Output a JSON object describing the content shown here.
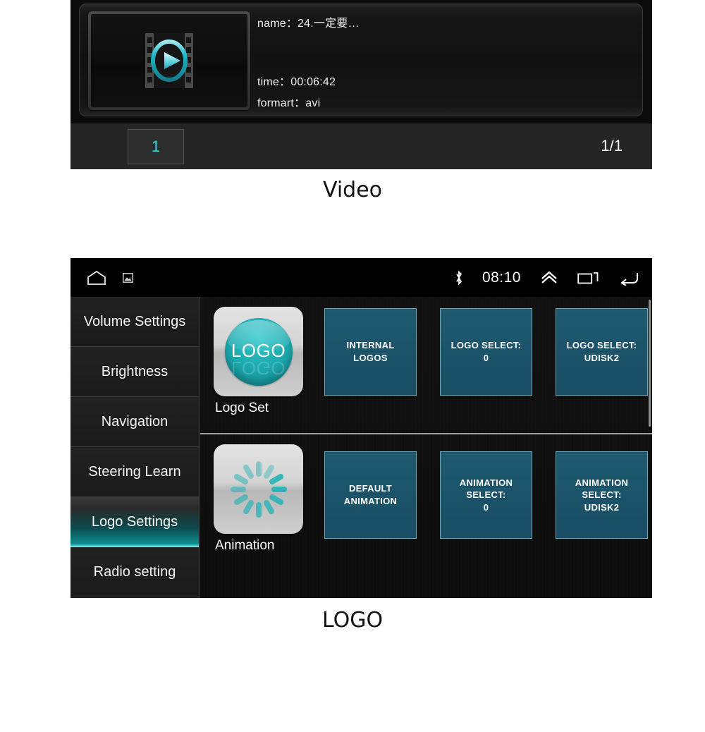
{
  "video_screen": {
    "caption": "Video",
    "item": {
      "thumbnail_icon": "film-play-icon",
      "name_label": "name：",
      "name_value": "24.一定要…",
      "time_label": "time：",
      "time_value": "00:06:42",
      "format_label": "formart：",
      "format_value": "avi"
    },
    "pagination": {
      "page_button": "1",
      "page_count": "1/1"
    },
    "colors": {
      "accent": "#2ae0e0",
      "background": "#0b0b0b",
      "bottom_bar": "#252525"
    }
  },
  "logo_screen": {
    "caption": "LOGO",
    "statusbar": {
      "home_icon": "home-icon",
      "screenshot_icon": "screenshot-icon",
      "bluetooth_icon": "bluetooth-icon",
      "time": "08:10",
      "expand_icon": "chevron-up-icon",
      "recents_icon": "recents-icon",
      "back_icon": "back-arrow-icon"
    },
    "sidebar": {
      "items": [
        {
          "label": "Volume Settings",
          "selected": false
        },
        {
          "label": "Brightness",
          "selected": false
        },
        {
          "label": "Navigation",
          "selected": false
        },
        {
          "label": "Steering Learn",
          "selected": false
        },
        {
          "label": "Logo Settings",
          "selected": true
        },
        {
          "label": "Radio setting",
          "selected": false
        }
      ]
    },
    "rows": [
      {
        "app_icon": "logo-icon",
        "app_icon_text": "LOGO",
        "app_label": "Logo Set",
        "tiles": [
          {
            "label": "INTERNAL LOGOS"
          },
          {
            "label": "LOGO SELECT:\n0"
          },
          {
            "label": "LOGO SELECT:\nUDISK2"
          }
        ]
      },
      {
        "app_icon": "spinner-icon",
        "app_label": "Animation",
        "tiles": [
          {
            "label": "DEFAULT\nANIMATION"
          },
          {
            "label": "ANIMATION\nSELECT:\n0"
          },
          {
            "label": "ANIMATION\nSELECT:\nUDISK2"
          }
        ]
      }
    ],
    "colors": {
      "tile_fill": "#1b536a",
      "tile_border": "#74a8b8",
      "selected_accent": "#0d8d90",
      "sidebar_bg": "#1c1c1c"
    }
  }
}
